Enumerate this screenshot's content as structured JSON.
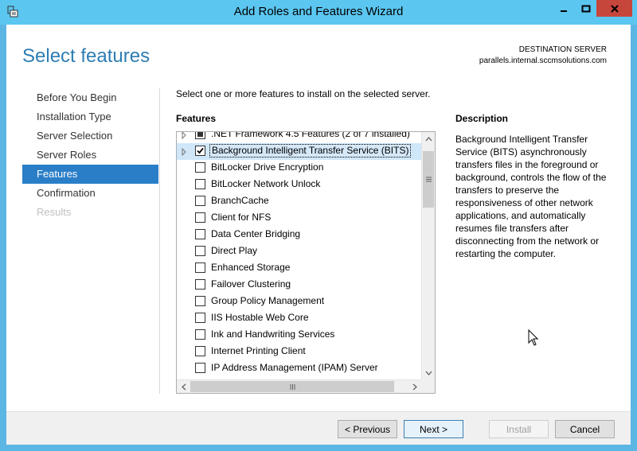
{
  "window": {
    "title": "Add Roles and Features Wizard",
    "icon": "server-manager-icon"
  },
  "header": {
    "page_title": "Select features",
    "destination_label": "DESTINATION SERVER",
    "destination_server": "parallels.internal.sccmsolutions.com"
  },
  "nav": {
    "items": [
      {
        "label": "Before You Begin",
        "state": "normal"
      },
      {
        "label": "Installation Type",
        "state": "normal"
      },
      {
        "label": "Server Selection",
        "state": "normal"
      },
      {
        "label": "Server Roles",
        "state": "normal"
      },
      {
        "label": "Features",
        "state": "active"
      },
      {
        "label": "Confirmation",
        "state": "normal"
      },
      {
        "label": "Results",
        "state": "disabled"
      }
    ]
  },
  "main": {
    "instruction": "Select one or more features to install on the selected server.",
    "features_header": "Features",
    "features": [
      {
        "label": ".NET Framework 4.5 Features (2 of 7 installed)",
        "checked": false,
        "expandable": true,
        "partial": true
      },
      {
        "label": "Background Intelligent Transfer Service (BITS)",
        "checked": true,
        "expandable": true,
        "selected": true
      },
      {
        "label": "BitLocker Drive Encryption",
        "checked": false
      },
      {
        "label": "BitLocker Network Unlock",
        "checked": false
      },
      {
        "label": "BranchCache",
        "checked": false
      },
      {
        "label": "Client for NFS",
        "checked": false
      },
      {
        "label": "Data Center Bridging",
        "checked": false
      },
      {
        "label": "Direct Play",
        "checked": false
      },
      {
        "label": "Enhanced Storage",
        "checked": false
      },
      {
        "label": "Failover Clustering",
        "checked": false
      },
      {
        "label": "Group Policy Management",
        "checked": false
      },
      {
        "label": "IIS Hostable Web Core",
        "checked": false
      },
      {
        "label": "Ink and Handwriting Services",
        "checked": false
      },
      {
        "label": "Internet Printing Client",
        "checked": false
      },
      {
        "label": "IP Address Management (IPAM) Server",
        "checked": false
      }
    ],
    "description_header": "Description",
    "description_text": "Background Intelligent Transfer Service (BITS) asynchronously transfers files in the foreground or background, controls the flow of the transfers to preserve the responsiveness of other network applications, and automatically resumes file transfers after disconnecting from the network or restarting the computer."
  },
  "footer": {
    "previous_label": "< Previous",
    "next_label": "Next >",
    "install_label": "Install",
    "cancel_label": "Cancel"
  },
  "colors": {
    "titlebar": "#5bc6f0",
    "accent": "#2d7db4",
    "nav_active": "#2a7ec7",
    "close_button": "#c7463b"
  }
}
